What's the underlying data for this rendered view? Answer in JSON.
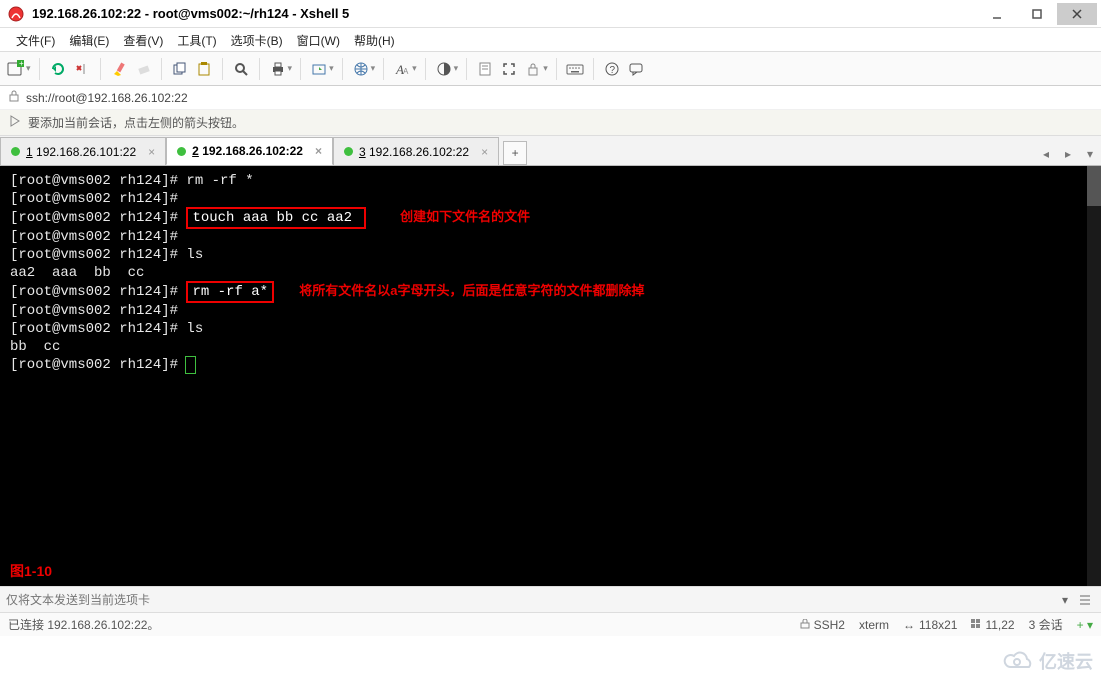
{
  "window": {
    "title": "192.168.26.102:22 - root@vms002:~/rh124 - Xshell 5"
  },
  "menu": {
    "file": "文件(F)",
    "edit": "编辑(E)",
    "view": "查看(V)",
    "tools": "工具(T)",
    "tabs": "选项卡(B)",
    "window": "窗口(W)",
    "help": "帮助(H)"
  },
  "addressbar": {
    "url": "ssh://root@192.168.26.102:22"
  },
  "tipbar": {
    "text": "要添加当前会话，点击左侧的箭头按钮。"
  },
  "tabs": [
    {
      "idx": "1",
      "label": "192.168.26.101:22",
      "active": false
    },
    {
      "idx": "2",
      "label": "192.168.26.102:22",
      "active": true
    },
    {
      "idx": "3",
      "label": "192.168.26.102:22",
      "active": false
    }
  ],
  "term": {
    "prompt": "[root@vms002 rh124]# ",
    "lines": [
      {
        "t": "plain",
        "text": "[root@vms002 rh124]# rm -rf *"
      },
      {
        "t": "plain",
        "text": "[root@vms002 rh124]# "
      },
      {
        "t": "box",
        "prefix": "[root@vms002 rh124]# ",
        "boxed": "touch aaa bb cc aa2 ",
        "anno": "创建如下文件名的文件",
        "gap": "    "
      },
      {
        "t": "plain",
        "text": "[root@vms002 rh124]# "
      },
      {
        "t": "plain",
        "text": "[root@vms002 rh124]# ls"
      },
      {
        "t": "plain",
        "text": "aa2  aaa  bb  cc"
      },
      {
        "t": "box",
        "prefix": "[root@vms002 rh124]# ",
        "boxed": "rm -rf a*",
        "anno": "将所有文件名以a字母开头，后面是任意字符的文件都删除掉",
        "gap": "   "
      },
      {
        "t": "plain",
        "text": "[root@vms002 rh124]# "
      },
      {
        "t": "plain",
        "text": "[root@vms002 rh124]# ls"
      },
      {
        "t": "plain",
        "text": "bb  cc"
      },
      {
        "t": "cursor",
        "text": "[root@vms002 rh124]# "
      }
    ],
    "figure": "图1-10"
  },
  "inputbar": {
    "placeholder": "仅将文本发送到当前选项卡"
  },
  "status": {
    "conn": "已连接 192.168.26.102:22。",
    "proto": "SSH2",
    "type": "xterm",
    "size": "118x21",
    "pos": "11,22",
    "sess": "3 会话"
  },
  "watermark": {
    "text": "亿速云"
  }
}
